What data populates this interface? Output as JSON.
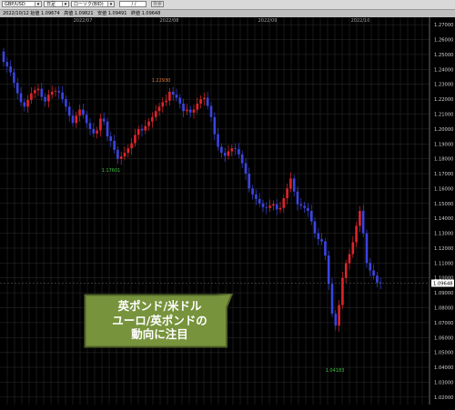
{
  "toolbar": {
    "symbol": "GBP/USD",
    "timeframe": "日足",
    "chart_style": "ローソク(BID)",
    "date_value": "/ /",
    "search_label": "検索"
  },
  "info_bar": {
    "date_open": "2022/10/12 始値 1.09674",
    "high": "高値 1.09821",
    "low": "安値 1.09491",
    "close": "終値 1.09648"
  },
  "callout": {
    "line1": "英ポンド/米ドル",
    "line2": "ユーロ/英ポンドの",
    "line3": "動向に注目",
    "fill_color": "#77933c",
    "border_color": "#4f6228"
  },
  "chart_data": {
    "type": "candlestick",
    "x_labels": [
      "2022/07",
      "2022/08",
      "2022/09",
      "2022/10"
    ],
    "y_ticks": [
      "1.27000",
      "1.26000",
      "1.25000",
      "1.24000",
      "1.23000",
      "1.22000",
      "1.21000",
      "1.20000",
      "1.19000",
      "1.18000",
      "1.17000",
      "1.16000",
      "1.15000",
      "1.14000",
      "1.13000",
      "1.12000",
      "1.11000",
      "1.10000",
      "1.09000",
      "1.08000",
      "1.07000",
      "1.06000",
      "1.05000",
      "1.04000",
      "1.03000",
      "1.02000"
    ],
    "ylim": [
      1.015,
      1.275
    ],
    "current_price": "1.09648",
    "annotations": [
      {
        "label": "1.17601",
        "price": 1.17601,
        "position": "below"
      },
      {
        "label": "1.22930",
        "price": 1.2293,
        "position": "above"
      },
      {
        "label": "1.04183",
        "price": 1.04183,
        "position": "below"
      }
    ],
    "colors": {
      "up": "#e0242b",
      "down": "#3a44e0",
      "background": "#000000",
      "grid": "#2e2e2e"
    },
    "close": [
      1.245,
      1.242,
      1.238,
      1.231,
      1.224,
      1.218,
      1.215,
      1.2195,
      1.224,
      1.226,
      1.227,
      1.2215,
      1.2185,
      1.223,
      1.225,
      1.2255,
      1.2245,
      1.22,
      1.215,
      1.209,
      1.204,
      1.209,
      1.213,
      1.2095,
      1.204,
      1.2,
      1.197,
      1.199,
      1.207,
      1.205,
      1.195,
      1.192,
      1.186,
      1.18,
      1.1815,
      1.184,
      1.187,
      1.1905,
      1.196,
      1.2,
      1.199,
      1.202,
      1.205,
      1.208,
      1.212,
      1.215,
      1.218,
      1.219,
      1.225,
      1.223,
      1.221,
      1.217,
      1.212,
      1.213,
      1.211,
      1.213,
      1.217,
      1.22,
      1.221,
      1.2155,
      1.208,
      1.1965,
      1.188,
      1.184,
      1.182,
      1.185,
      1.187,
      1.1865,
      1.183,
      1.177,
      1.17,
      1.16,
      1.156,
      1.153,
      1.15,
      1.1475,
      1.147,
      1.1485,
      1.1495,
      1.146,
      1.147,
      1.1535,
      1.16,
      1.1668,
      1.158,
      1.1495,
      1.1485,
      1.147,
      1.145,
      1.138,
      1.13,
      1.126,
      1.1245,
      1.115,
      1.096,
      1.076,
      1.068,
      1.0818,
      1.1,
      1.1098,
      1.116,
      1.124,
      1.135,
      1.145,
      1.13,
      1.11,
      1.105,
      1.1015,
      1.097,
      1.0965
    ]
  }
}
